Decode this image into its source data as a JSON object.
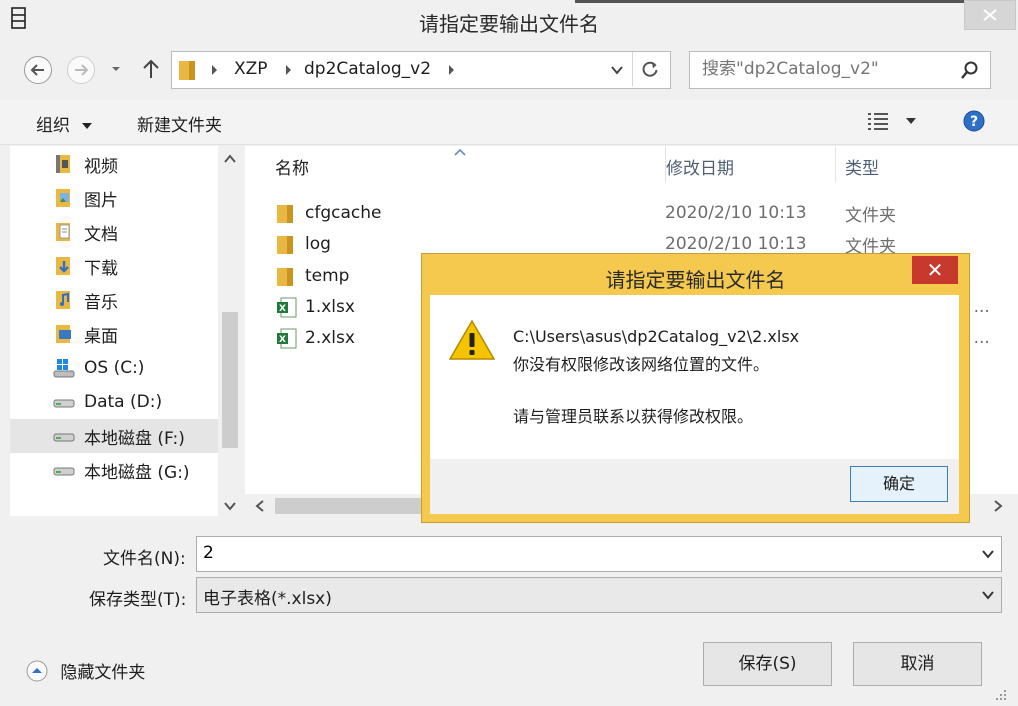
{
  "window": {
    "title": "请指定要输出文件名"
  },
  "address": {
    "segments": [
      "XZP",
      "dp2Catalog_v2"
    ]
  },
  "search": {
    "placeholder": "搜索\"dp2Catalog_v2\""
  },
  "toolbar": {
    "organize_label": "组织",
    "new_folder_label": "新建文件夹"
  },
  "nav": {
    "items": [
      {
        "label": "视频",
        "icon": "video-library-icon"
      },
      {
        "label": "图片",
        "icon": "pictures-library-icon"
      },
      {
        "label": "文档",
        "icon": "documents-library-icon"
      },
      {
        "label": "下载",
        "icon": "downloads-icon"
      },
      {
        "label": "音乐",
        "icon": "music-library-icon"
      },
      {
        "label": "桌面",
        "icon": "desktop-icon"
      },
      {
        "label": "OS (C:)",
        "icon": "system-drive-icon"
      },
      {
        "label": "Data (D:)",
        "icon": "drive-icon"
      },
      {
        "label": "本地磁盘 (F:)",
        "icon": "drive-icon",
        "selected": true
      },
      {
        "label": "本地磁盘 (G:)",
        "icon": "drive-icon"
      }
    ]
  },
  "columns": {
    "name": "名称",
    "date": "修改日期",
    "type": "类型"
  },
  "files": [
    {
      "name": "cfgcache",
      "date": "2020/2/10 10:13",
      "type": "文件夹",
      "icon": "folder-icon"
    },
    {
      "name": "log",
      "date": "2020/2/10 10:13",
      "type": "文件夹",
      "icon": "folder-icon"
    },
    {
      "name": "temp",
      "date": "",
      "type": "",
      "icon": "folder-icon"
    },
    {
      "name": "1.xlsx",
      "date": "",
      "type": "el ...",
      "icon": "excel-file-icon"
    },
    {
      "name": "2.xlsx",
      "date": "",
      "type": "el ...",
      "icon": "excel-file-icon"
    }
  ],
  "filename": {
    "label": "文件名(N):",
    "value": "2"
  },
  "filetype": {
    "label": "保存类型(T):",
    "value": "电子表格(*.xlsx)"
  },
  "footer": {
    "hide_folders_label": "隐藏文件夹",
    "save_label": "保存(S)",
    "cancel_label": "取消"
  },
  "dialog": {
    "title": "请指定要输出文件名",
    "path": "C:\\Users\\asus\\dp2Catalog_v2\\2.xlsx",
    "message": "你没有权限修改该网络位置的文件。",
    "hint": "请与管理员联系以获得修改权限。",
    "ok_label": "确定",
    "close_glyph": "✕"
  },
  "colors": {
    "dialog_frame": "#f4c94d",
    "dialog_close": "#c7382d",
    "header_text": "#4f5f74"
  }
}
